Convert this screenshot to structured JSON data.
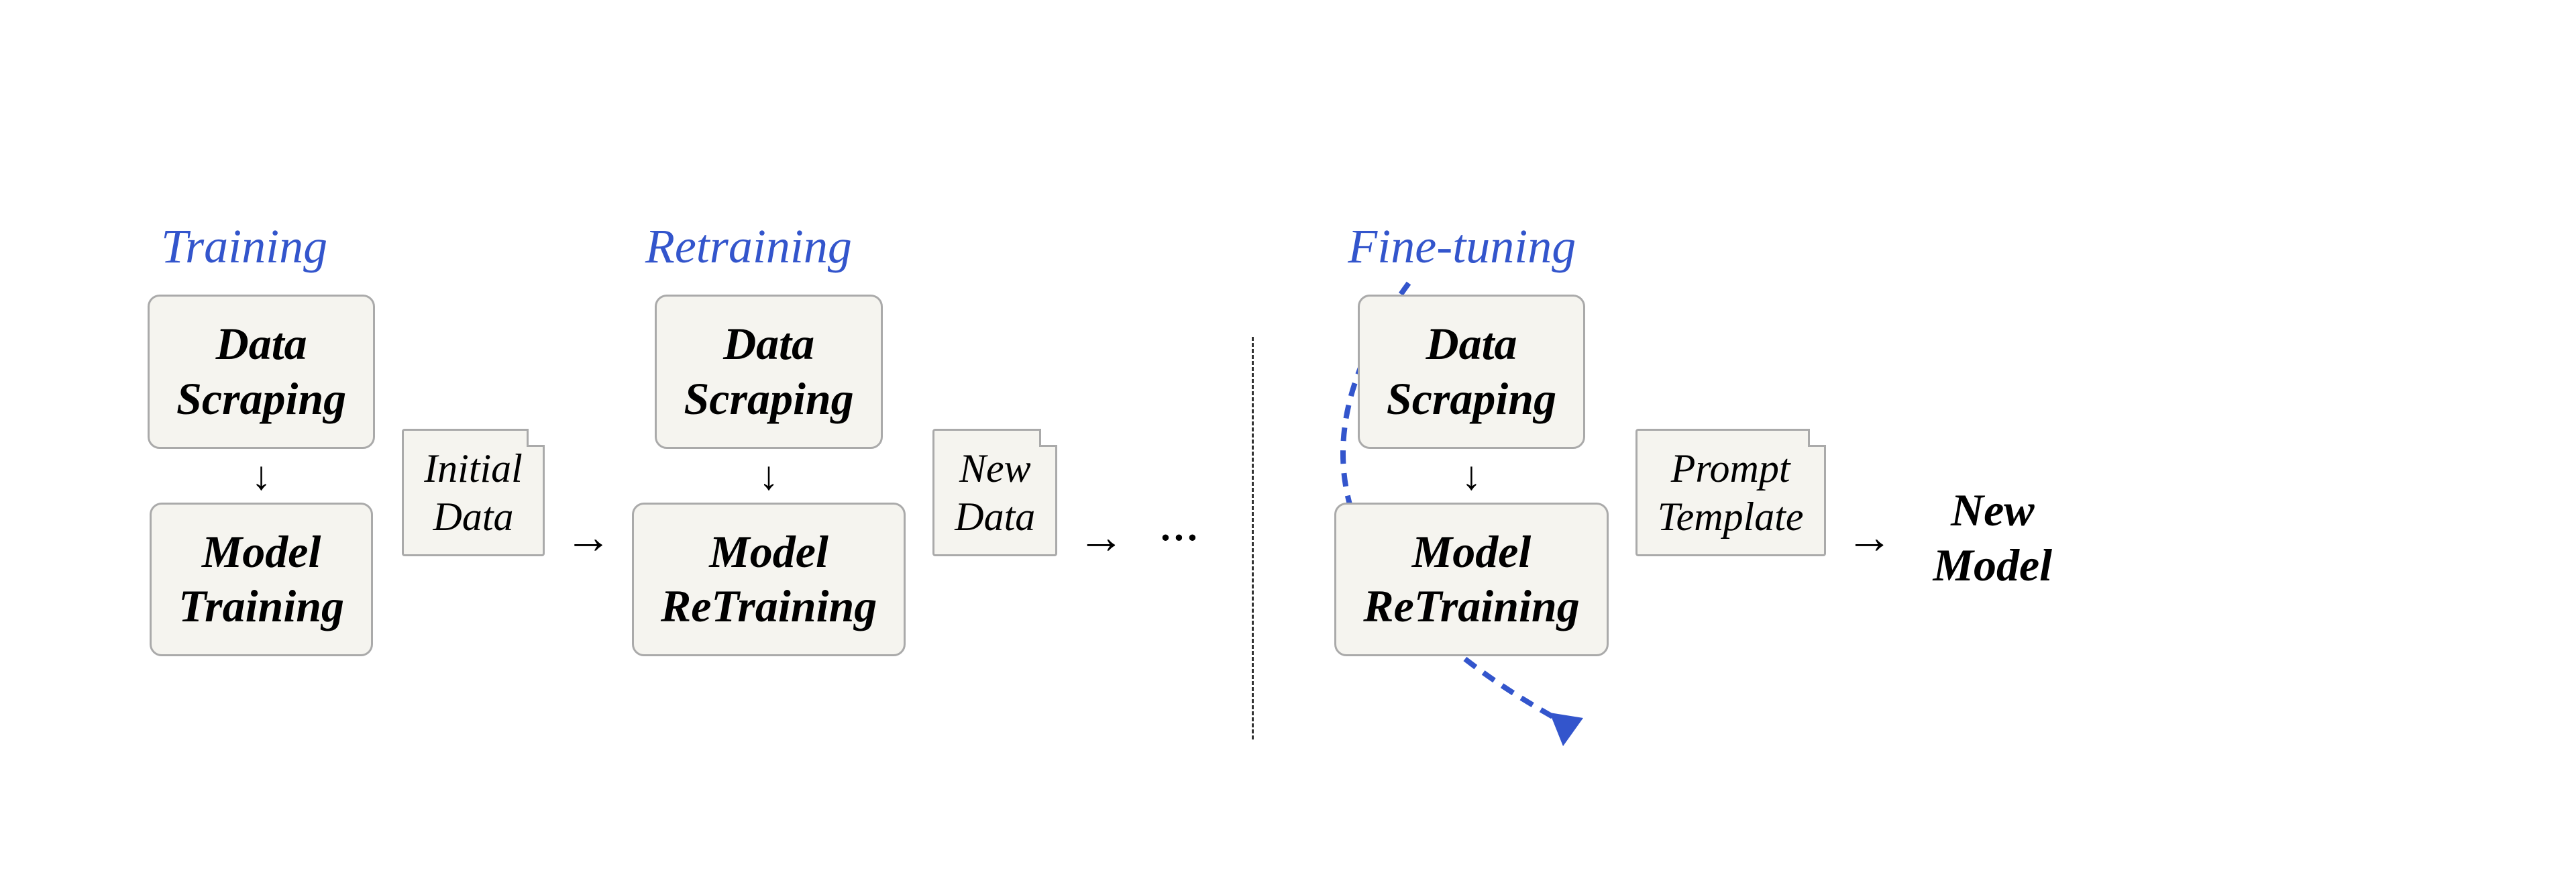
{
  "sections": {
    "training": {
      "title": "Training",
      "scraping_label": "Data\nScraping",
      "note_label": "Initial\nData",
      "model_label": "Model\nTraining"
    },
    "retraining": {
      "title": "Retraining",
      "scraping_label": "Data\nScraping",
      "note_label": "New\nData",
      "model_label": "Model\nReTraining"
    },
    "finetuning": {
      "title": "Fine-tuning",
      "scraping_label": "Data\nScraping",
      "note_label": "Prompt\nTemplate",
      "model_label": "Model\nReTraining"
    },
    "output": {
      "label": "New\nModel"
    }
  },
  "arrows": {
    "down": "↓",
    "right": "→",
    "dots": "···"
  },
  "colors": {
    "title": "#3355cc",
    "box_bg": "#f5f4ef",
    "box_border": "#aaaaaa",
    "arrow": "#000000",
    "dashed_arc": "#3355cc"
  }
}
